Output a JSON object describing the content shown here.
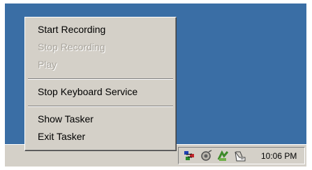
{
  "desktop": {
    "background": "#3a6ea5"
  },
  "context_menu": {
    "items": [
      {
        "label": "Start Recording",
        "enabled": true
      },
      {
        "label": "Stop Recording",
        "enabled": false
      },
      {
        "label": "Play",
        "enabled": false
      },
      {
        "label": "Stop Keyboard Service",
        "enabled": true
      },
      {
        "label": "Show Tasker",
        "enabled": true
      },
      {
        "label": "Exit Tasker",
        "enabled": true
      }
    ]
  },
  "taskbar": {
    "tray_icons": [
      "network-icon",
      "volume-icon",
      "tasker-icon",
      "printer-icon"
    ],
    "clock": "10:06 PM"
  }
}
